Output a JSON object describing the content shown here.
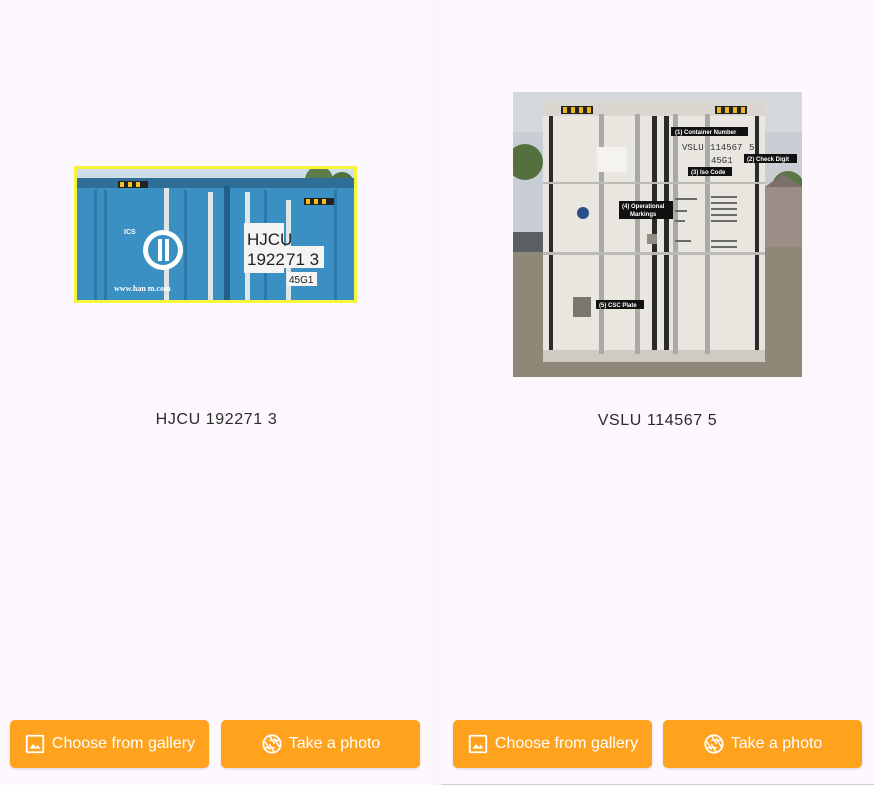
{
  "screens": [
    {
      "result_text": "HJCU 192271 3",
      "image": {
        "container_number_text": [
          "HJCU",
          "1922",
          "71 3"
        ],
        "iso_code_text": "45G1",
        "website_text": "www.han   m.com"
      },
      "buttons": {
        "gallery_label": "Choose from gallery",
        "gallery_icon": "image-icon",
        "camera_label": "Take a photo",
        "camera_icon": "camera-shutter-icon"
      }
    },
    {
      "result_text": "VSLU 114567 5",
      "image": {
        "container_number_text": [
          "VSLU",
          "114567",
          "5"
        ],
        "iso_code_text": "45G1",
        "annotations": [
          "(1) Container Number",
          "(2) Check Digit",
          "(3) Iso Code",
          "(4) Operational",
          "Markings",
          "(5) CSC Plate"
        ]
      },
      "buttons": {
        "gallery_label": "Choose from gallery",
        "gallery_icon": "image-icon",
        "camera_label": "Take a photo",
        "camera_icon": "camera-shutter-icon"
      }
    }
  ],
  "colors": {
    "background": "#fdf8fd",
    "button": "#ffa21d",
    "button_text": "#ffffff",
    "highlight_border": "#f5f53a",
    "container_blue": "#3a8fc3",
    "container_white": "#e9e6df"
  }
}
